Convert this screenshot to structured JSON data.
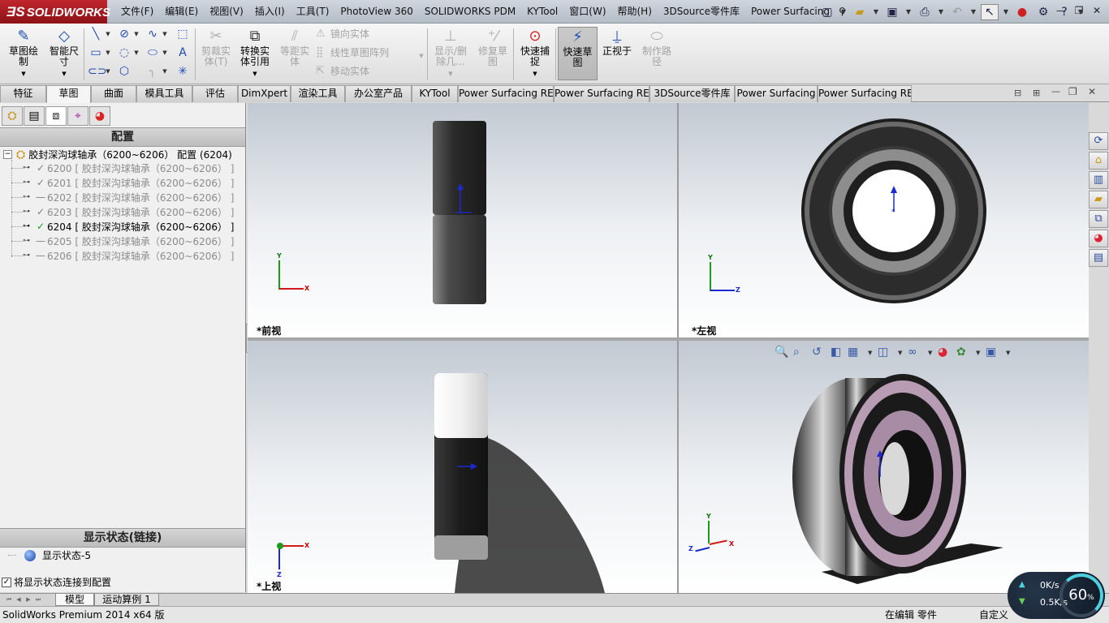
{
  "app": {
    "logo_text": "SOLIDWORKS",
    "menu": [
      "文件(F)",
      "编辑(E)",
      "视图(V)",
      "插入(I)",
      "工具(T)",
      "PhotoView 360",
      "SOLIDWORKS PDM",
      "KYTool",
      "窗口(W)",
      "帮助(H)",
      "3DSource零件库",
      "Power Surfacing"
    ]
  },
  "ribbon": {
    "sketch": "草图绘\n制",
    "smart_dim": "智能尺\n寸",
    "trim": "剪裁实\n体(T)",
    "convert": "转换实\n体引用",
    "offset": "等距实\n体",
    "mirror": "镜向实体",
    "linear_pattern": "线性草图阵列",
    "move": "移动实体",
    "show_delete": "显示/删\n除几...",
    "repair": "修复草\n图",
    "quick_snap": "快速捕\n捉",
    "rapid_sketch": "快速草\n图",
    "normal_to": "正视于",
    "make_path": "制作路\n径"
  },
  "tabs": [
    "特征",
    "草图",
    "曲面",
    "模具工具",
    "评估",
    "DimXpert",
    "渲染工具",
    "办公室产品",
    "KYTool",
    "Power Surfacing RE",
    "Power Surfacing RE",
    "3DSource零件库",
    "Power Surfacing",
    "Power Surfacing RE"
  ],
  "config_panel": {
    "header": "配置",
    "root": "胶封深沟球轴承（6200~6206）  配置  (6204)",
    "items": [
      {
        "label": "6200 [ 胶封深沟球轴承（6200~6206） ]",
        "mark": "✓"
      },
      {
        "label": "6201 [ 胶封深沟球轴承（6200~6206） ]",
        "mark": "✓"
      },
      {
        "label": "6202 [ 胶封深沟球轴承（6200~6206） ]",
        "mark": "—"
      },
      {
        "label": "6203 [ 胶封深沟球轴承（6200~6206） ]",
        "mark": "✓"
      },
      {
        "label": "6204 [ 胶封深沟球轴承（6200~6206） ]",
        "mark": "✓"
      },
      {
        "label": "6205 [ 胶封深沟球轴承（6200~6206） ]",
        "mark": "—"
      },
      {
        "label": "6206 [ 胶封深沟球轴承（6200~6206） ]",
        "mark": "—"
      }
    ],
    "display_state_header": "显示状态(链接)",
    "display_state": "显示状态-5",
    "link_checkbox": "将显示状态连接到配置",
    "link_checked": true
  },
  "viewports": {
    "front": "*前视",
    "left": "*左视",
    "top": "*上视",
    "axis_x": "X",
    "axis_y": "Y",
    "axis_z": "Z"
  },
  "bottom_tabs": [
    "模型",
    "运动算例 1"
  ],
  "status": {
    "app_version": "SolidWorks Premium 2014 x64 版",
    "mode": "在编辑 零件",
    "units": "自定义"
  },
  "net_widget": {
    "up": "0K/s",
    "down": "0.5K/s",
    "percent": "60",
    "percent_unit": "%"
  },
  "colors": {
    "logo_bg": "#b01c24",
    "active_check": "#17a01c",
    "axis_x": "#d01818",
    "axis_y": "#1a9b1a",
    "axis_z": "#1a2ad0"
  }
}
